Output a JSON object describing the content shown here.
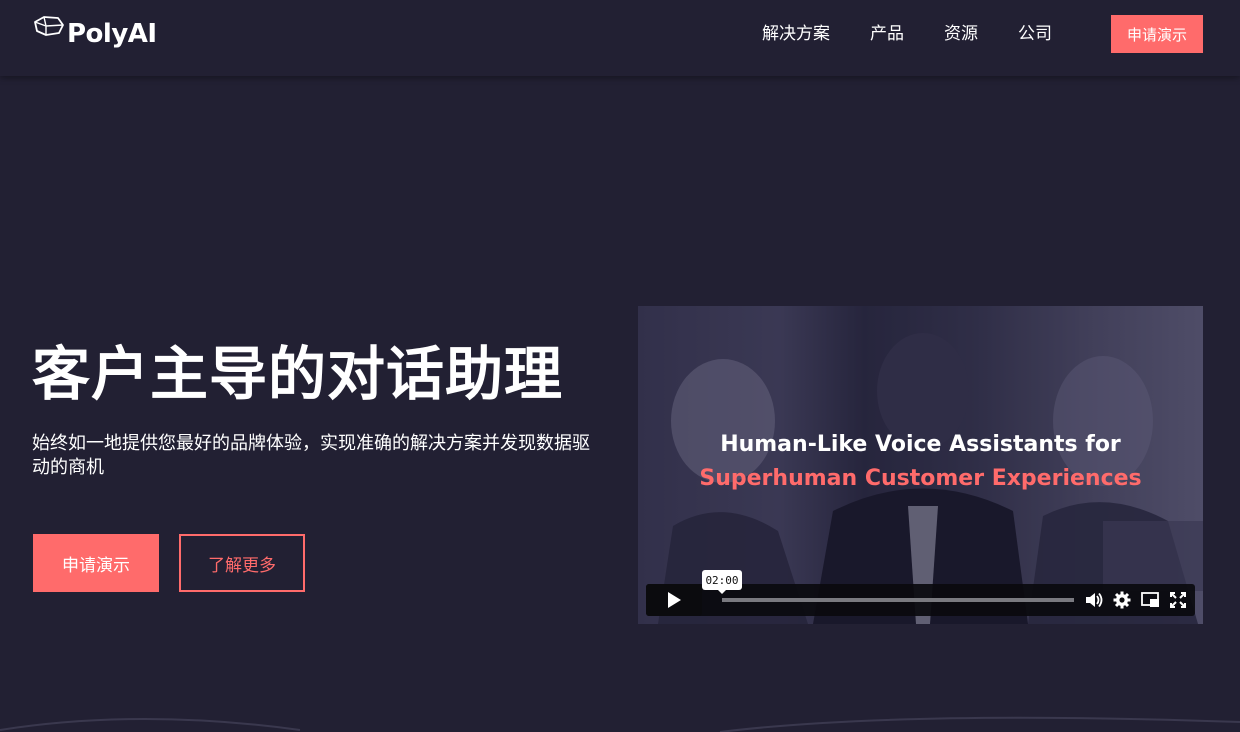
{
  "header": {
    "logo_text": "PolyAI",
    "nav": [
      "解决方案",
      "产品",
      "资源",
      "公司"
    ],
    "cta_label": "申请演示"
  },
  "hero": {
    "title": "客户主导的对话助理",
    "subtitle": "始终如一地提供您最好的品牌体验，实现准确的解决方案并发现数据驱动的商机",
    "primary_button": "申请演示",
    "secondary_button": "了解更多"
  },
  "video": {
    "headline_line1": "Human-Like Voice Assistants for",
    "headline_line2": "Superhuman Customer Experiences",
    "duration": "02:00",
    "icons": [
      "play-icon",
      "volume-icon",
      "settings-icon",
      "pip-icon",
      "fullscreen-icon"
    ]
  },
  "colors": {
    "background": "#222033",
    "accent": "#ff6b6b",
    "text": "#ffffff"
  }
}
